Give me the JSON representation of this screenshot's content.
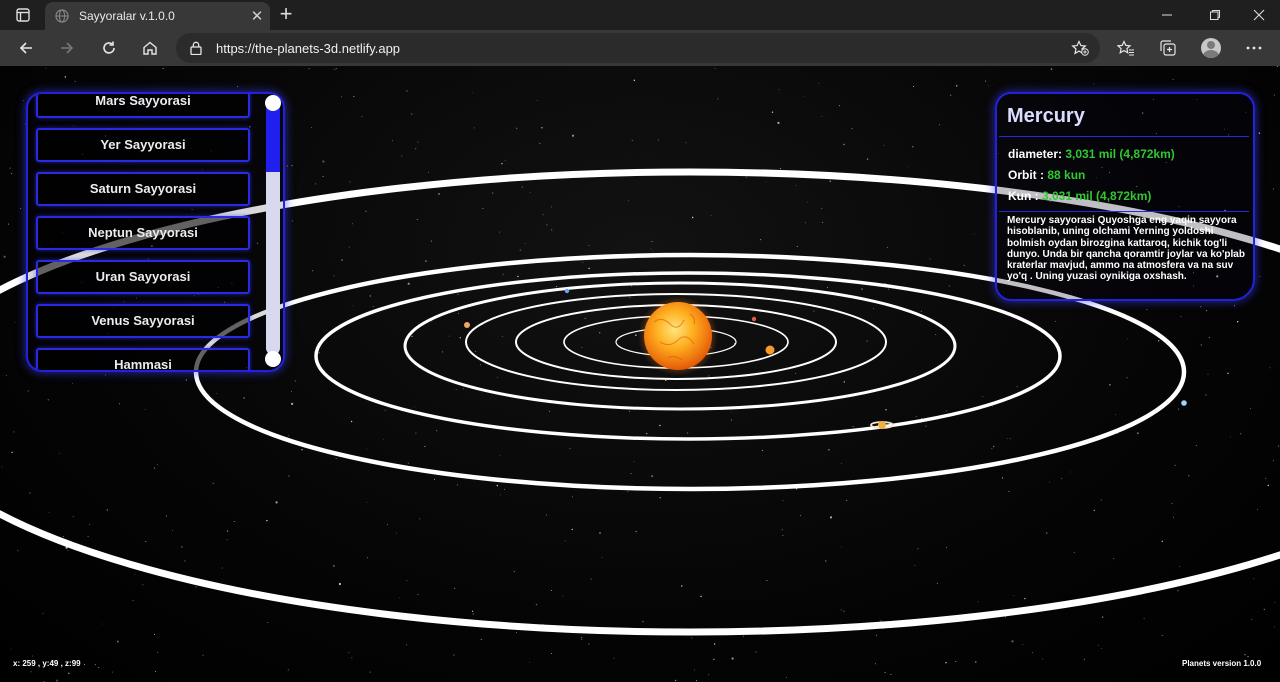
{
  "browser": {
    "tab_title": "Sayyoralar v.1.0.0",
    "url": "https://the-planets-3d.netlify.app",
    "icons": [
      "tab-actions-icon",
      "globe-icon",
      "close-icon",
      "plus-icon",
      "minimize-icon",
      "maximize-icon",
      "close-window-icon",
      "back-arrow-icon",
      "forward-arrow-icon",
      "refresh-icon",
      "home-icon",
      "lock-icon",
      "star-plus-icon",
      "favorites-icon",
      "collections-icon",
      "profile-icon",
      "more-dots-icon"
    ]
  },
  "menu": {
    "items": [
      {
        "label": "Mars Sayyorasi"
      },
      {
        "label": "Yer Sayyorasi"
      },
      {
        "label": "Saturn Sayyorasi"
      },
      {
        "label": "Neptun Sayyorasi"
      },
      {
        "label": "Uran Sayyorasi"
      },
      {
        "label": "Venus Sayyorasi"
      },
      {
        "label": "Hammasi"
      }
    ],
    "scroll_position": 0.28
  },
  "info": {
    "name": "Mercury",
    "diameter_label": "diameter:",
    "diameter_value": "3,031 mil (4,872km)",
    "orbit_label": "Orbit :",
    "orbit_value": "88 kun",
    "kun_label": "Kun :",
    "kun_value": "3,031 mil (4,872km)",
    "description": "Mercury sayyorasi Quyoshga eng yaqin sayyora hisoblanib, uning olchami Yerning yoldoshi bolmish oydan birozgina kattaroq, kichik tog'li dunyo. Unda bir qancha qoramtir joylar va ko'plab kraterlar mavjud, ammo na atmosfera va na suv yo'q . Uning yuzasi oynikiga oxshash.",
    "value_color": "#2fc82f"
  },
  "footer": {
    "coords": "x: 259 , y:49 , z:99",
    "version": "Planets version 1.0.0"
  },
  "colors": {
    "panel_border": "#2222dd",
    "sun": "#ff9a10",
    "orbit": "#ffffff"
  }
}
